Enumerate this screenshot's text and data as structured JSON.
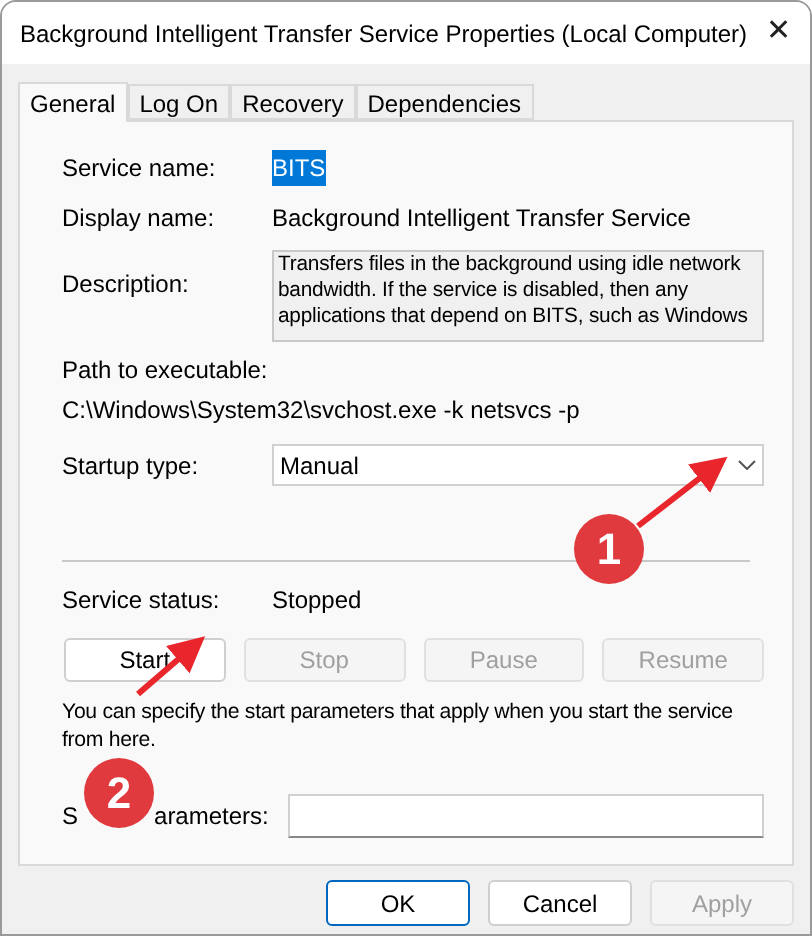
{
  "window": {
    "title": "Background Intelligent Transfer Service Properties (Local Computer)",
    "close": "✕"
  },
  "tabs": [
    {
      "label": "General",
      "selected": true
    },
    {
      "label": "Log On",
      "selected": false
    },
    {
      "label": "Recovery",
      "selected": false
    },
    {
      "label": "Dependencies",
      "selected": false
    }
  ],
  "service_name": {
    "label": "Service name:",
    "value": "BITS",
    "selected": true
  },
  "display_name": {
    "label": "Display name:",
    "value": "Background Intelligent Transfer Service"
  },
  "description": {
    "label": "Description:",
    "value": "Transfers files in the background using idle network bandwidth. If the service is disabled, then any applications that depend on BITS, such as Windows"
  },
  "path": {
    "label": "Path to executable:",
    "value": "C:\\Windows\\System32\\svchost.exe -k netsvcs -p"
  },
  "startup_type": {
    "label": "Startup type:",
    "value": "Manual"
  },
  "service_status": {
    "label": "Service status:",
    "value": "Stopped"
  },
  "service_buttons": [
    {
      "label": "Start",
      "disabled": false
    },
    {
      "label": "Stop",
      "disabled": true
    },
    {
      "label": "Pause",
      "disabled": true
    },
    {
      "label": "Resume",
      "disabled": true
    }
  ],
  "hint": "You can specify the start parameters that apply when you start the service from here.",
  "start_parameters": {
    "label_parts": [
      "S",
      "arameters:"
    ]
  },
  "dialog_buttons": [
    {
      "label": "OK",
      "default": true,
      "disabled": false
    },
    {
      "label": "Cancel",
      "default": false,
      "disabled": false
    },
    {
      "label": "Apply",
      "default": false,
      "disabled": true
    }
  ],
  "annotations": [
    {
      "number": "1"
    },
    {
      "number": "2"
    }
  ]
}
